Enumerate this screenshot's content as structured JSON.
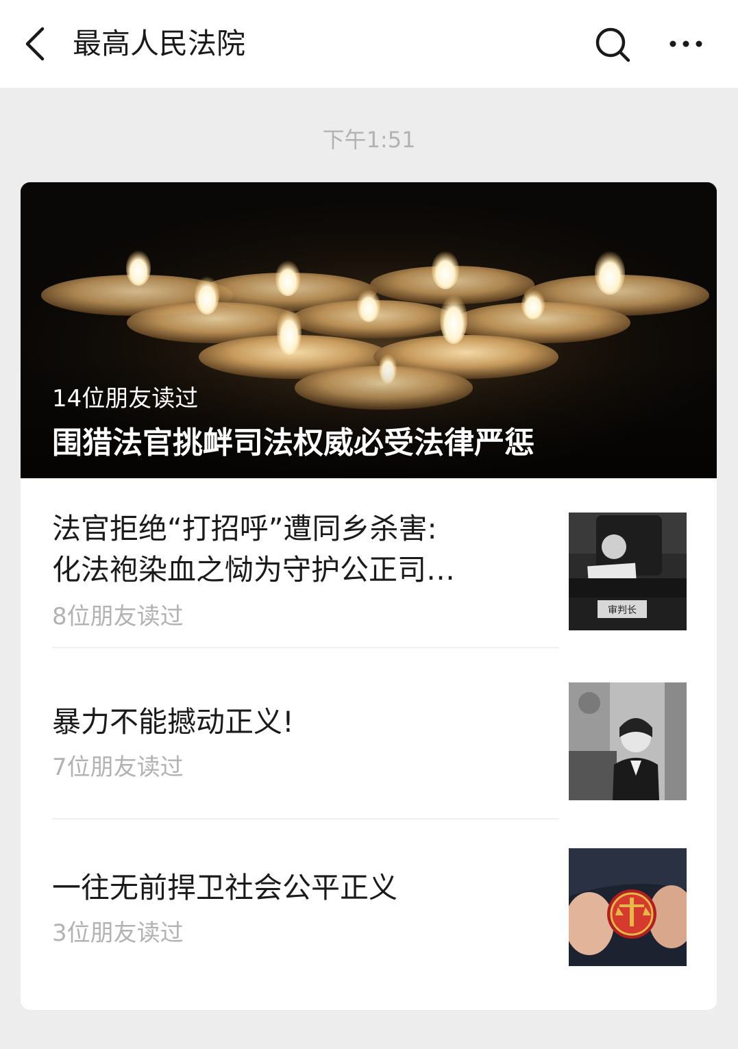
{
  "header": {
    "title": "最高人民法院"
  },
  "timestamp": "下午1:51",
  "hero": {
    "readers": "14位朋友读过",
    "title": "围猎法官挑衅司法权威必受法律严惩"
  },
  "articles": [
    {
      "title_line1": "法官拒绝“打招呼”遭同乡杀害:",
      "title_line2": "化法袍染血之恸为守护公正司…",
      "readers": "8位朋友读过",
      "thumb_caption": "审判长"
    },
    {
      "title": "暴力不能撼动正义!",
      "readers": "7位朋友读过"
    },
    {
      "title": "一往无前捍卫社会公平正义",
      "readers": "3位朋友读过"
    }
  ],
  "icons": {
    "back": "chevron-left-icon",
    "search": "search-icon",
    "more": "more-dots-icon"
  },
  "colors": {
    "page_bg": "#ededed",
    "header_bg": "#ffffff",
    "card_bg": "#ffffff",
    "muted_text": "#b2b2b2",
    "title_text": "#1a1a1a"
  }
}
